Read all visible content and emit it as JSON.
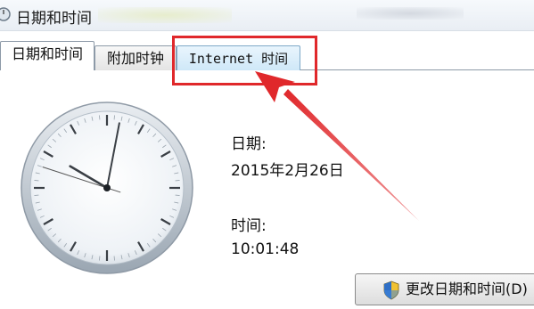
{
  "window": {
    "title": "日期和时间"
  },
  "tabs": [
    {
      "label": "日期和时间",
      "selected": true
    },
    {
      "label": "附加时钟",
      "selected": false
    },
    {
      "label": "Internet 时间",
      "selected": false,
      "highlighted": true
    }
  ],
  "datetime": {
    "date_label": "日期:",
    "date_value": "2015年2月26日",
    "time_label": "时间:",
    "time_value": "10:01:48"
  },
  "clock": {
    "hour": 10,
    "minute": 1,
    "second": 48
  },
  "buttons": {
    "change_label": "更改日期和时间(D)"
  },
  "icons": {
    "window": "clock-icon",
    "button": "uac-shield-icon"
  },
  "colors": {
    "annotation": "#e0282b",
    "selected_tab": "#ffffff",
    "highlight_tab": "#cfe8f8"
  }
}
